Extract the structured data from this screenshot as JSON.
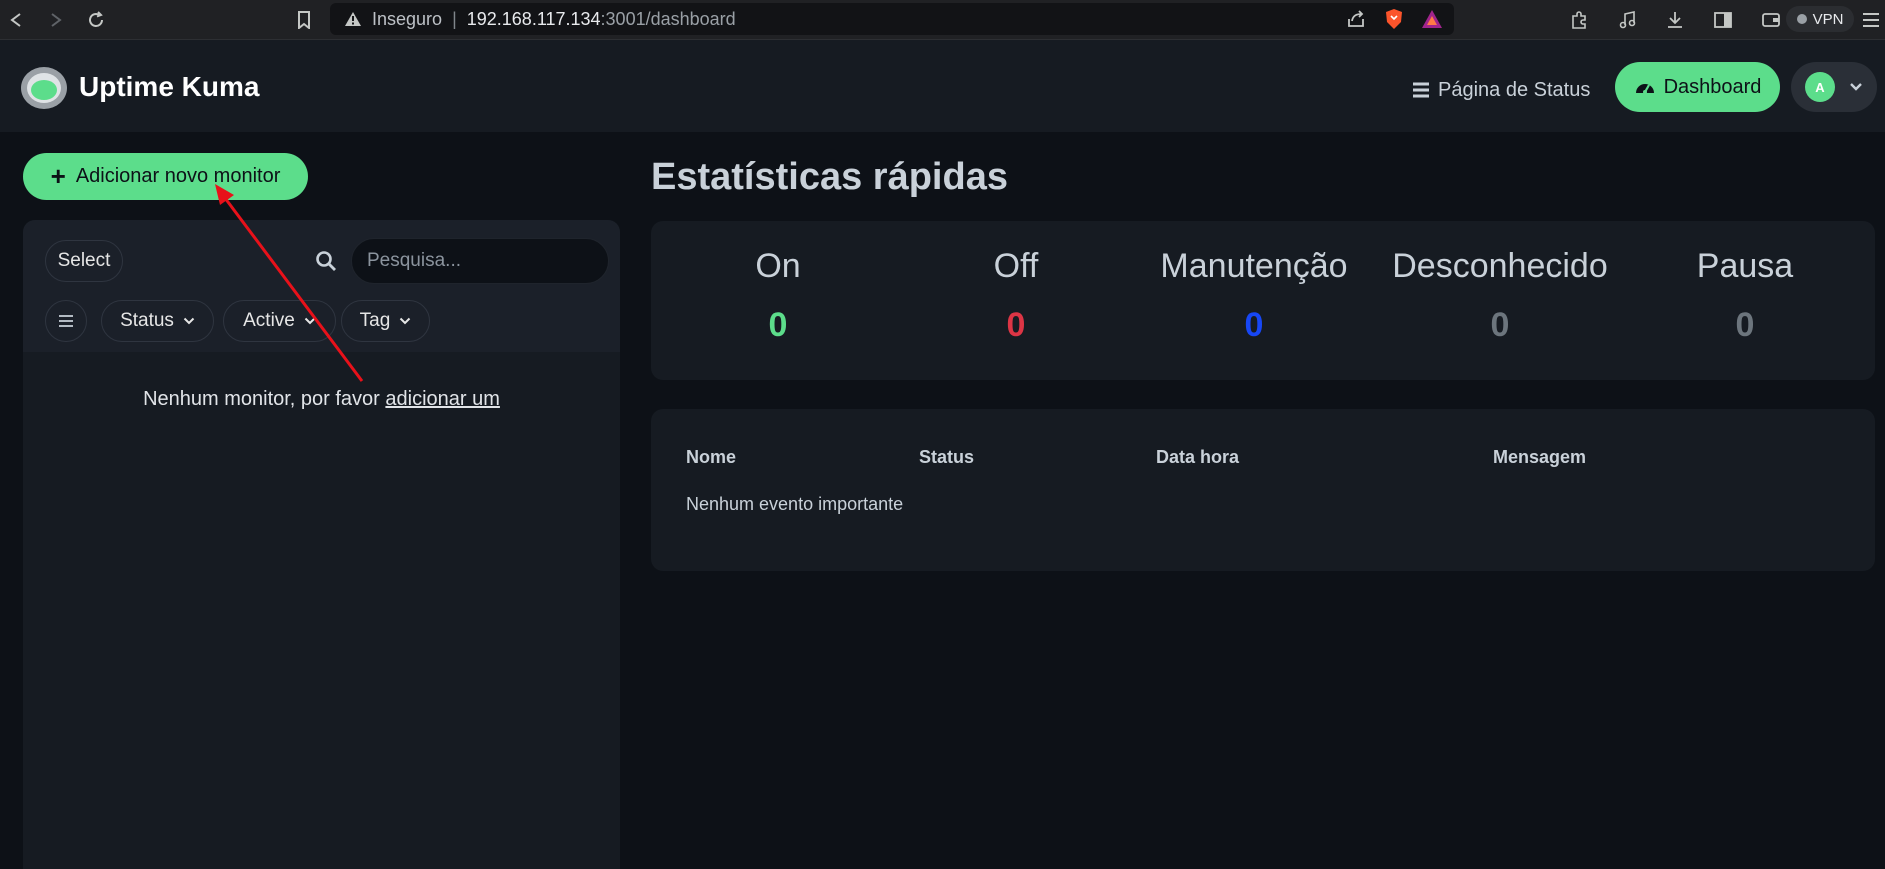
{
  "browser": {
    "security_label": "Inseguro",
    "url_host": "192.168.117.134",
    "url_path": ":3001/dashboard",
    "vpn_label": "VPN"
  },
  "header": {
    "app_title": "Uptime Kuma",
    "status_page_label": "Página de Status",
    "dashboard_label": "Dashboard",
    "avatar_initial": "A"
  },
  "sidebar": {
    "add_monitor_label": "Adicionar novo monitor",
    "select_label": "Select",
    "search_placeholder": "Pesquisa...",
    "filters": [
      {
        "label": "Status"
      },
      {
        "label": "Active"
      },
      {
        "label": "Tag"
      }
    ],
    "empty_text": "Nenhum monitor, por favor",
    "empty_link": "adicionar um"
  },
  "stats": {
    "title": "Estatísticas rápidas",
    "items": [
      {
        "label": "On",
        "value": "0",
        "color": "#5cdd8b"
      },
      {
        "label": "Off",
        "value": "0",
        "color": "#dc3545"
      },
      {
        "label": "Manutenção",
        "value": "0",
        "color": "#1747f5"
      },
      {
        "label": "Desconhecido",
        "value": "0",
        "color": "#6c757d"
      },
      {
        "label": "Pausa",
        "value": "0",
        "color": "#6c757d"
      }
    ]
  },
  "events": {
    "columns": [
      "Nome",
      "Status",
      "Data hora",
      "Mensagem"
    ],
    "empty_text": "Nenhum evento importante"
  },
  "colors": {
    "accent": "#5cdd8b",
    "annotation": "#e8111a"
  }
}
